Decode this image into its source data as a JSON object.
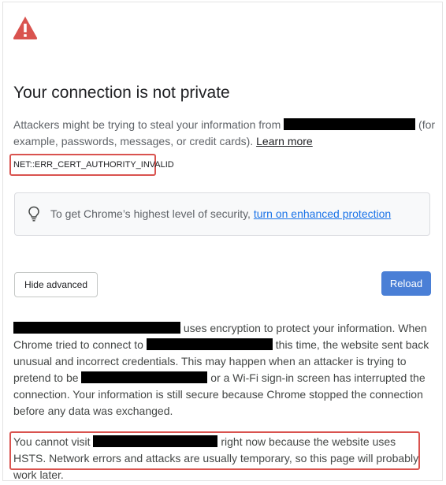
{
  "page": {
    "title": "Your connection is not private",
    "intro_before": "Attackers might be trying to steal your information from ",
    "intro_after": " (for example, passwords, messages, or credit cards). ",
    "learn_more": "Learn more",
    "error_code": "NET::ERR_CERT_AUTHORITY_INVALID"
  },
  "promo": {
    "text_before": "To get Chrome’s highest level of security, ",
    "link": "turn on enhanced protection"
  },
  "buttons": {
    "hide_advanced": "Hide advanced",
    "reload": "Reload"
  },
  "details": {
    "p1_a": " uses encryption to protect your information. When Chrome tried to connect to ",
    "p1_b": " this time, the website sent back unusual and incorrect credentials. This may happen when an attacker is trying to pretend to be ",
    "p1_c": " or a Wi-Fi sign-in screen has interrupted the connection. Your information is still secure because Chrome stopped the connection before any data was exchanged."
  },
  "hsts": {
    "before": "You cannot visit ",
    "after": " right now because the website uses HSTS. Network errors and attacks are usually temporary, so this page will probably work later."
  },
  "icons": {
    "warning": "warning-triangle-icon",
    "bulb": "lightbulb-icon"
  },
  "colors": {
    "warning": "#d9534f",
    "link": "#1a73e8",
    "reload_button": "#4a7fd6",
    "annotation_box": "#d9534f"
  }
}
